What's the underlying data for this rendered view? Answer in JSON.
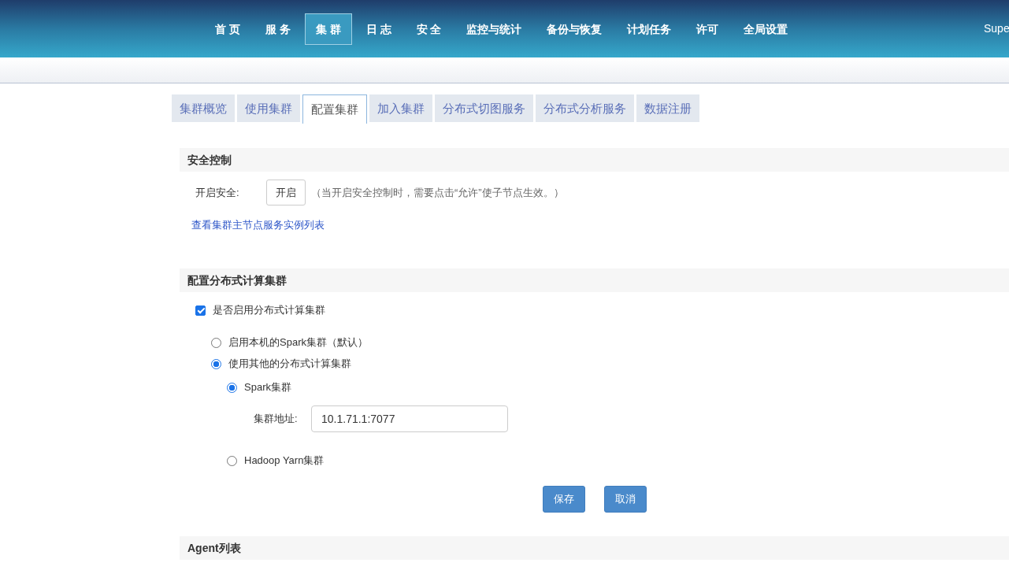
{
  "top_nav": {
    "items": [
      {
        "label": "首 页",
        "selected": false
      },
      {
        "label": "服 务",
        "selected": false
      },
      {
        "label": "集 群",
        "selected": true
      },
      {
        "label": "日 志",
        "selected": false
      },
      {
        "label": "安 全",
        "selected": false
      },
      {
        "label": "监控与统计",
        "selected": false
      },
      {
        "label": "备份与恢复",
        "selected": false
      },
      {
        "label": "计划任务",
        "selected": false
      },
      {
        "label": "许可",
        "selected": false
      },
      {
        "label": "全局设置",
        "selected": false
      }
    ],
    "user": "Supe"
  },
  "tabs": [
    {
      "label": "集群概览",
      "selected": false
    },
    {
      "label": "使用集群",
      "selected": false
    },
    {
      "label": "配置集群",
      "selected": true
    },
    {
      "label": "加入集群",
      "selected": false
    },
    {
      "label": "分布式切图服务",
      "selected": false
    },
    {
      "label": "分布式分析服务",
      "selected": false
    },
    {
      "label": "数据注册",
      "selected": false
    }
  ],
  "security": {
    "title": "安全控制",
    "label": "开启安全:",
    "button": "开启",
    "hint": "（当开启安全控制时，需要点击“允许”使子节点生效。）",
    "link": "查看集群主节点服务实例列表"
  },
  "compute": {
    "title": "配置分布式计算集群",
    "enable": {
      "label": "是否启用分布式计算集群",
      "checked": true
    },
    "options": [
      {
        "label": "启用本机的Spark集群（默认）",
        "selected": false
      },
      {
        "label": "使用其他的分布式计算集群",
        "selected": true,
        "children": [
          {
            "label": "Spark集群",
            "selected": true,
            "field": {
              "label": "集群地址:",
              "value": "10.1.71.1:7077"
            }
          },
          {
            "label": "Hadoop Yarn集群",
            "selected": false
          }
        ]
      }
    ],
    "buttons": [
      "保存",
      "取消"
    ]
  },
  "agent": {
    "title": "Agent列表"
  }
}
